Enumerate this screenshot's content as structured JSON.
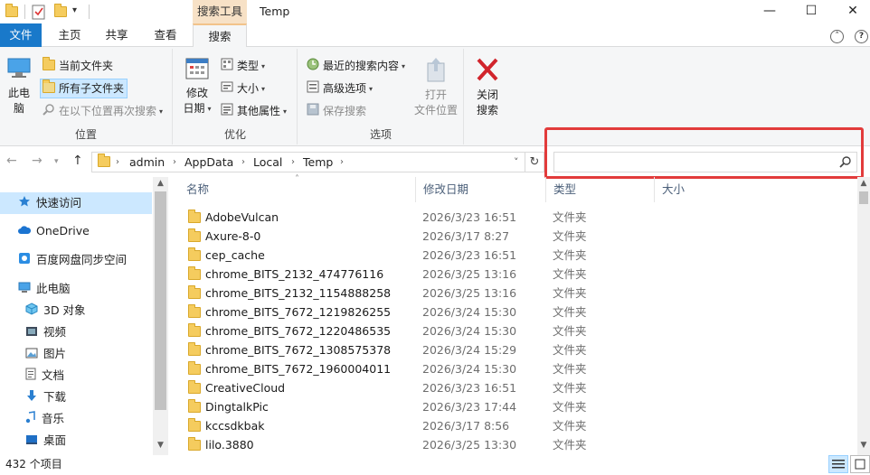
{
  "window": {
    "title": "Temp",
    "context_tab_title": "搜索工具"
  },
  "window_buttons": {
    "minimize": "—",
    "maximize": "☐",
    "close": "✕"
  },
  "tabs": {
    "file": "文件",
    "home": "主页",
    "share": "共享",
    "view": "查看",
    "search": "搜索"
  },
  "ribbon": {
    "location": {
      "this_pc_line1": "此电",
      "this_pc_line2": "脑",
      "current_folder": "当前文件夹",
      "all_subfolders": "所有子文件夹",
      "search_again": "在以下位置再次搜索",
      "group_label": "位置"
    },
    "refine": {
      "date_line1": "修改",
      "date_line2": "日期",
      "kind": "类型",
      "size": "大小",
      "other_props": "其他属性",
      "group_label": "优化"
    },
    "options": {
      "recent_searches": "最近的搜索内容",
      "advanced_options": "高级选项",
      "save_search": "保存搜索",
      "open_location_line1": "打开",
      "open_location_line2": "文件位置",
      "group_label": "选项"
    },
    "close": {
      "line1": "关闭",
      "line2": "搜索"
    }
  },
  "address": {
    "crumbs": [
      "admin",
      "AppData",
      "Local",
      "Temp"
    ],
    "search_placeholder": ""
  },
  "navpane": {
    "items": [
      "快速访问",
      "OneDrive",
      "百度网盘同步空间",
      "此电脑",
      "3D 对象",
      "视频",
      "图片",
      "文档",
      "下载",
      "音乐",
      "桌面"
    ]
  },
  "columns": {
    "name": "名称",
    "date": "修改日期",
    "type": "类型",
    "size": "大小"
  },
  "files": [
    {
      "name": "AdobeVulcan",
      "date": "2026/3/23 16:51",
      "type": "文件夹"
    },
    {
      "name": "Axure-8-0",
      "date": "2026/3/17 8:27",
      "type": "文件夹"
    },
    {
      "name": "cep_cache",
      "date": "2026/3/23 16:51",
      "type": "文件夹"
    },
    {
      "name": "chrome_BITS_2132_474776116",
      "date": "2026/3/25 13:16",
      "type": "文件夹"
    },
    {
      "name": "chrome_BITS_2132_1154888258",
      "date": "2026/3/25 13:16",
      "type": "文件夹"
    },
    {
      "name": "chrome_BITS_7672_1219826255",
      "date": "2026/3/24 15:30",
      "type": "文件夹"
    },
    {
      "name": "chrome_BITS_7672_1220486535",
      "date": "2026/3/24 15:30",
      "type": "文件夹"
    },
    {
      "name": "chrome_BITS_7672_1308575378",
      "date": "2026/3/24 15:29",
      "type": "文件夹"
    },
    {
      "name": "chrome_BITS_7672_1960004011",
      "date": "2026/3/24 15:30",
      "type": "文件夹"
    },
    {
      "name": "CreativeCloud",
      "date": "2026/3/23 16:51",
      "type": "文件夹"
    },
    {
      "name": "DingtalkPic",
      "date": "2026/3/23 17:44",
      "type": "文件夹"
    },
    {
      "name": "kccsdkbak",
      "date": "2026/3/17 8:56",
      "type": "文件夹"
    },
    {
      "name": "lilo.3880",
      "date": "2026/3/25 13:30",
      "type": "文件夹"
    }
  ],
  "status": {
    "item_count": "432 个项目"
  },
  "colors": {
    "accent": "#1979ca",
    "selection": "#cce8ff",
    "highlight_box": "#e23b3b",
    "context_tab": "#f7e1c6"
  }
}
